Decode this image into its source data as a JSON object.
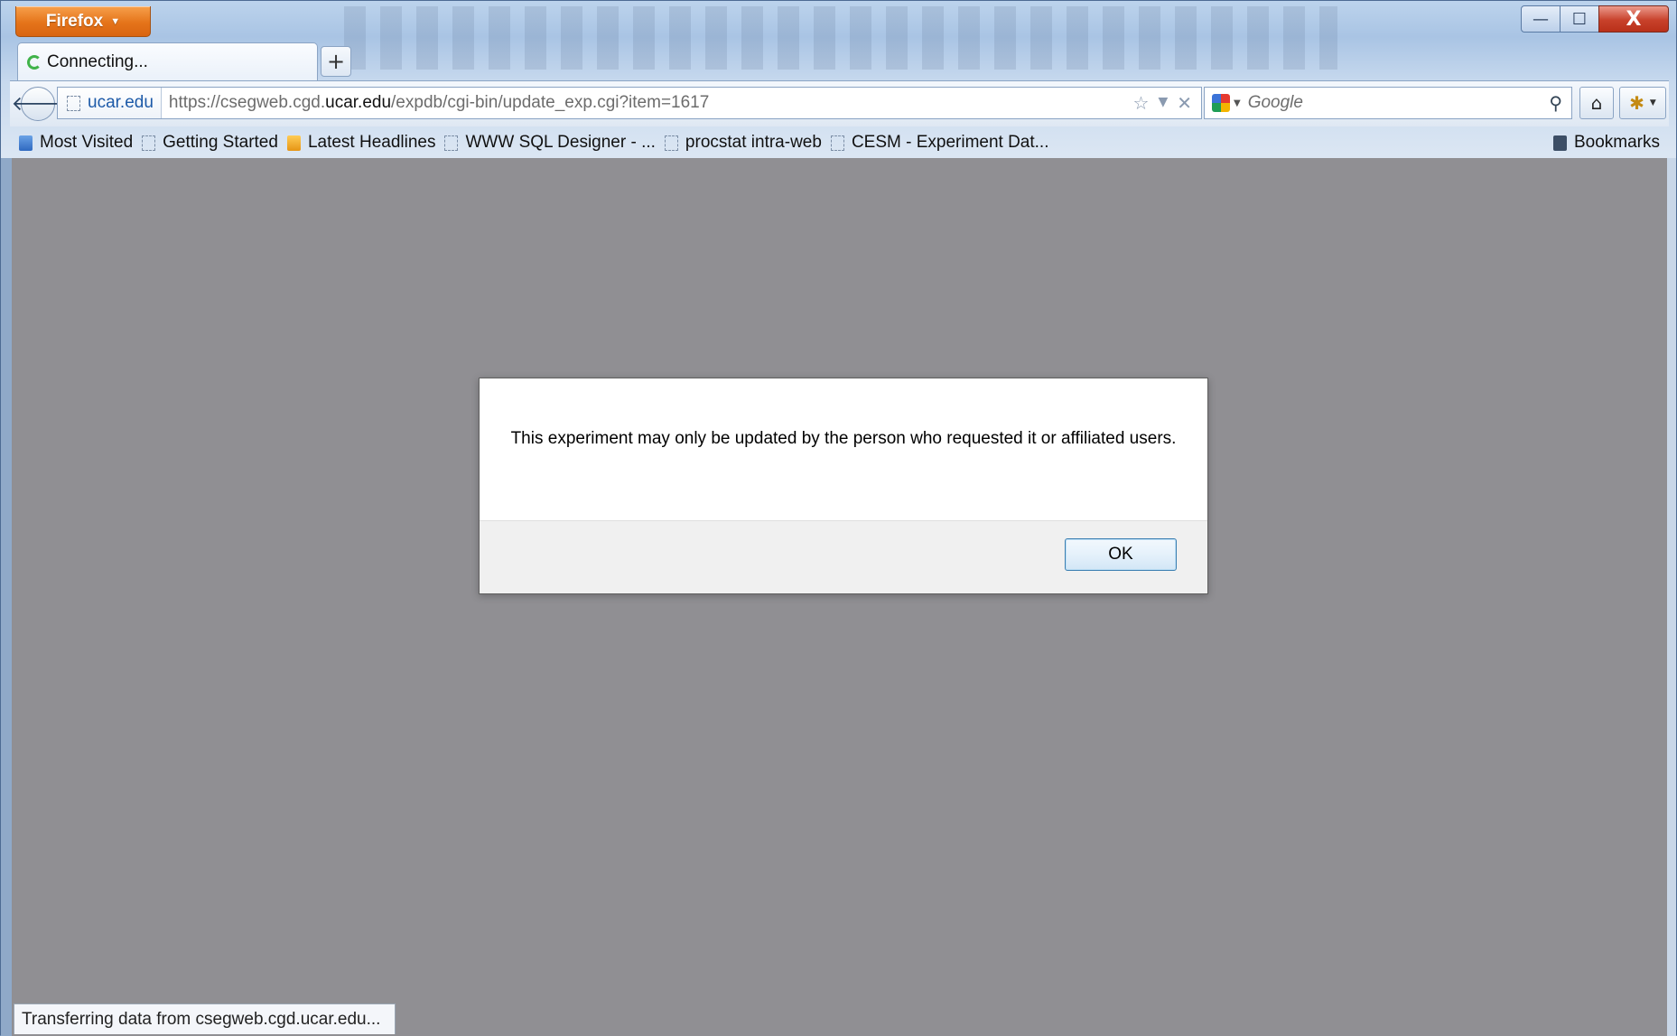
{
  "app": {
    "menu_label": "Firefox"
  },
  "window_controls": {
    "minimize": "—",
    "maximize": "☐",
    "close": "X"
  },
  "tab": {
    "title": "Connecting..."
  },
  "new_tab": "+",
  "navigation": {
    "identity": "ucar.edu",
    "url_prefix": "https://csegweb.cgd.",
    "url_domain": "ucar.edu",
    "url_path": "/expdb/cgi-bin/update_exp.cgi?item=1617",
    "search_placeholder": "Google"
  },
  "bookmarks": {
    "items": [
      {
        "label": "Most Visited",
        "icon": "most-visited-icon"
      },
      {
        "label": "Getting Started",
        "icon": "page-icon"
      },
      {
        "label": "Latest Headlines",
        "icon": "rss-icon"
      },
      {
        "label": "WWW SQL Designer - ...",
        "icon": "page-icon"
      },
      {
        "label": "procstat intra-web",
        "icon": "page-icon"
      },
      {
        "label": "CESM - Experiment Dat...",
        "icon": "page-icon"
      }
    ],
    "menu_label": "Bookmarks"
  },
  "dialog": {
    "message": "This experiment may only be updated by the person who requested it or affiliated users.",
    "ok_label": "OK"
  },
  "status": {
    "text": "Transferring data from csegweb.cgd.ucar.edu..."
  }
}
